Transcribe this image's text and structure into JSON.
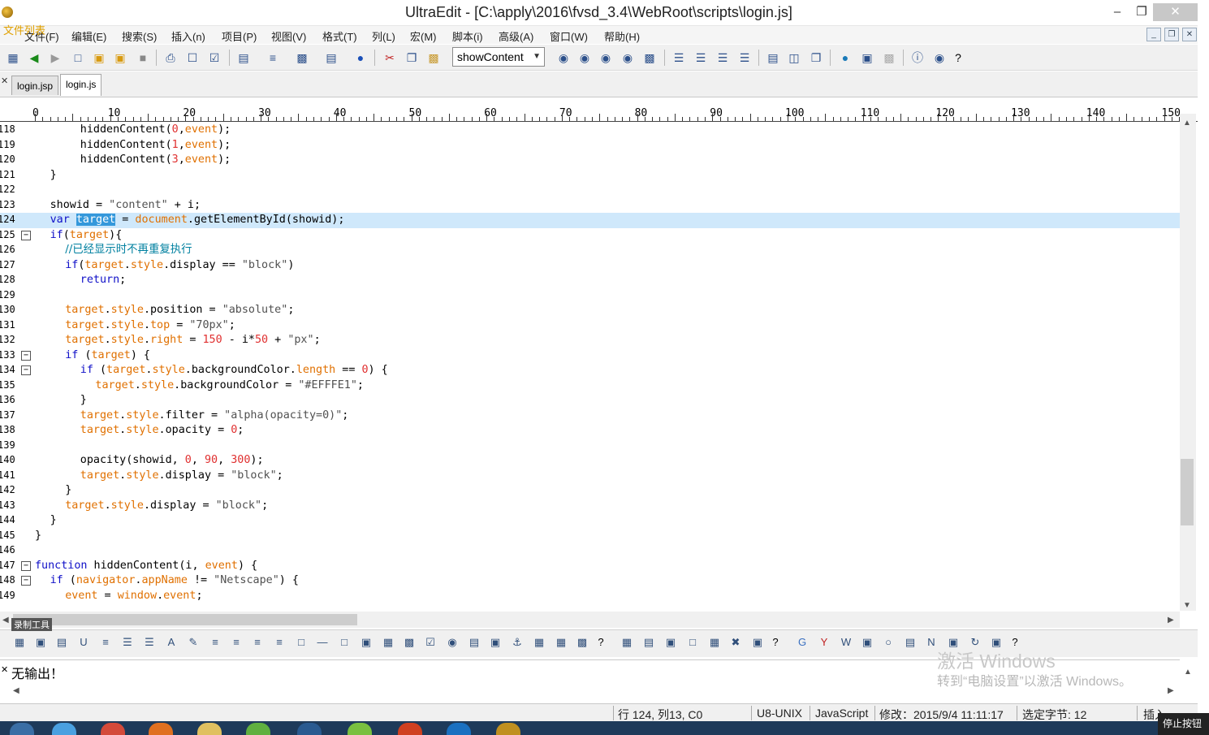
{
  "window": {
    "title": "UltraEdit - [C:\\apply\\2016\\fvsd_3.4\\WebRoot\\scripts\\login.js]"
  },
  "menu": {
    "overlay": "文件列表",
    "items": [
      "文件(F)",
      "编辑(E)",
      "搜索(S)",
      "插入(n)",
      "项目(P)",
      "视图(V)",
      "格式(T)",
      "列(L)",
      "宏(M)",
      "脚本(i)",
      "高级(A)",
      "窗口(W)",
      "帮助(H)"
    ]
  },
  "toolbar": {
    "function_select": "showContent"
  },
  "tabs": [
    "login.jsp",
    "login.js"
  ],
  "ruler": [
    "0",
    "10",
    "20",
    "30",
    "40",
    "50",
    "60",
    "70",
    "80",
    "90",
    "100",
    "110",
    "120",
    "130",
    "140",
    "150"
  ],
  "editor": {
    "line_numbers": [
      "118",
      "119",
      "120",
      "121",
      "122",
      "123",
      "124",
      "125",
      "126",
      "127",
      "128",
      "129",
      "130",
      "131",
      "132",
      "133",
      "134",
      "135",
      "136",
      "137",
      "138",
      "139",
      "140",
      "141",
      "142",
      "143",
      "144",
      "145",
      "146",
      "147",
      "148",
      "149"
    ],
    "current_line": "124"
  },
  "recorder": "录制工具",
  "output": {
    "text": "无输出！"
  },
  "watermark": {
    "line1": "激活 Windows",
    "line2": "转到“电脑设置”以激活 Windows。"
  },
  "status": {
    "position": "行 124, 列13, C0",
    "encoding": "U8-UNIX",
    "language": "JavaScript",
    "modified": "修改：2015/9/4 11:11:17",
    "selected": "选定字节: 12",
    "mode": "插入"
  },
  "taskbar": {
    "stop_label": "停止按钮"
  }
}
